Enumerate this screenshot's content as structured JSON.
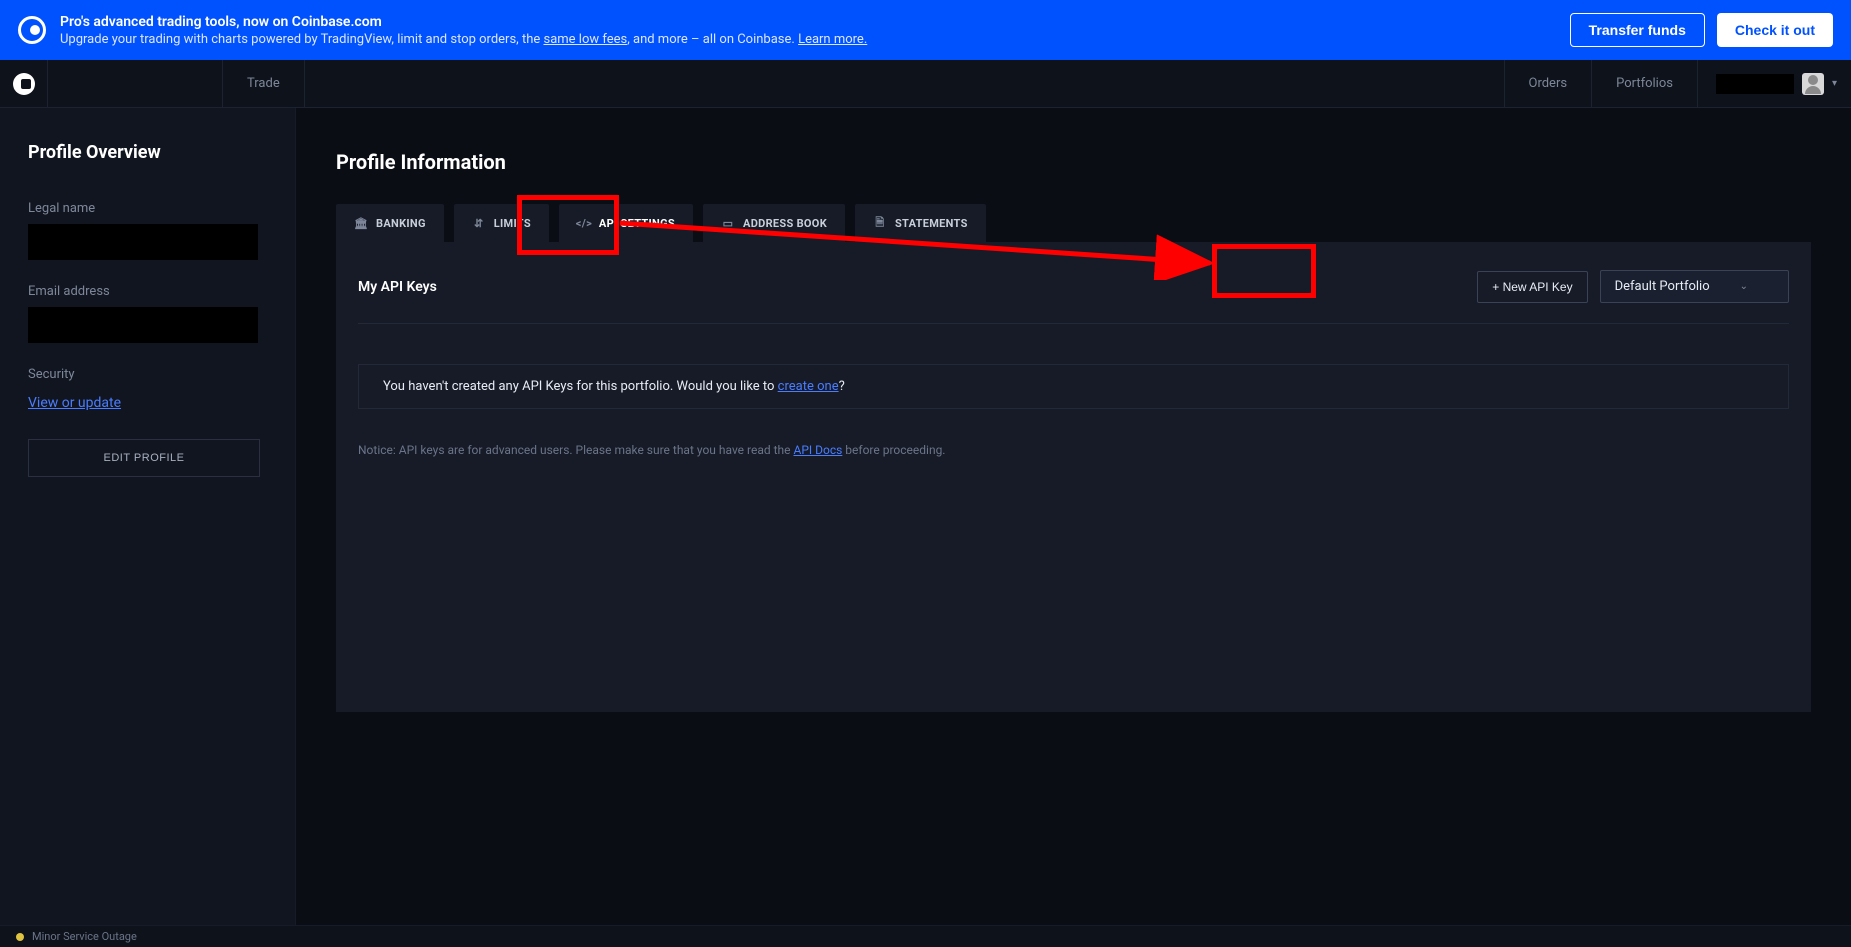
{
  "banner": {
    "title": "Pro's advanced trading tools, now on Coinbase.com",
    "sub_pre": "Upgrade your trading with charts powered by TradingView, limit and stop orders, the ",
    "sub_link1": "same low fees",
    "sub_mid": ", and more – all on Coinbase. ",
    "sub_link2": "Learn more.",
    "transfer": "Transfer funds",
    "checkout": "Check it out"
  },
  "nav": {
    "trade": "Trade",
    "orders": "Orders",
    "portfolios": "Portfolios"
  },
  "sidebar": {
    "heading": "Profile Overview",
    "legal_label": "Legal name",
    "email_label": "Email address",
    "security_label": "Security",
    "security_link": "View or update",
    "edit_button": "EDIT PROFILE"
  },
  "main": {
    "heading": "Profile Information",
    "tabs": {
      "banking": "BANKING",
      "limits": "LIMITS",
      "api": "API SETTINGS",
      "address": "ADDRESS BOOK",
      "statements": "STATEMENTS"
    },
    "panel": {
      "title": "My API Keys",
      "new_key": "+ New API Key",
      "portfolio": "Default Portfolio",
      "empty_pre": "You haven't created any API Keys for this portfolio. Would you like to ",
      "empty_link": "create one",
      "empty_post": "?",
      "notice_pre": "Notice: API keys are for advanced users. Please make sure that you have read the ",
      "notice_link": "API Docs",
      "notice_post": " before proceeding."
    }
  },
  "status": {
    "text": "Minor Service Outage"
  }
}
